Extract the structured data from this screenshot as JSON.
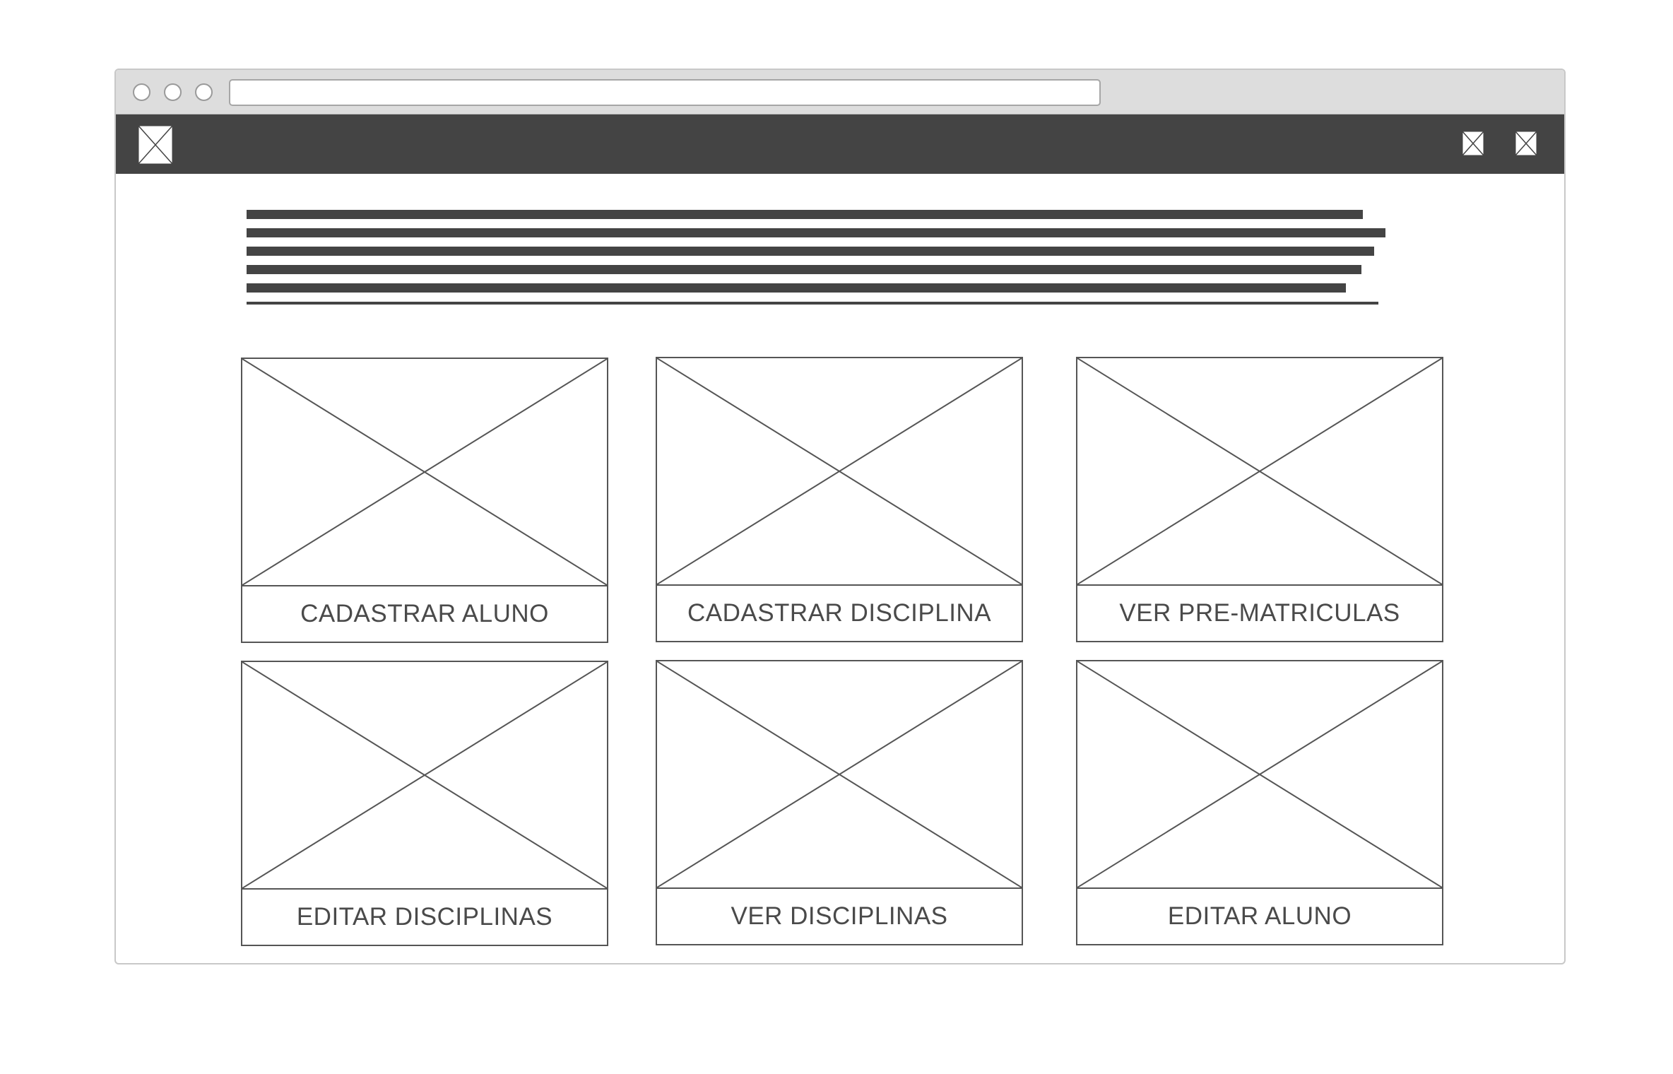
{
  "browser": {
    "window_controls": [
      "close",
      "minimize",
      "maximize"
    ],
    "address_bar": {
      "value": ""
    }
  },
  "navbar": {
    "logo_icon": "image-placeholder-icon",
    "right_icons": [
      "image-placeholder-icon",
      "image-placeholder-icon"
    ],
    "background": "#444444"
  },
  "intro_text": {
    "line_count": 6
  },
  "cards": [
    {
      "label": "CADASTRAR ALUNO",
      "icon": "image-placeholder-icon"
    },
    {
      "label": "CADASTRAR DISCIPLINA",
      "icon": "image-placeholder-icon"
    },
    {
      "label": "VER PRE-MATRICULAS",
      "icon": "image-placeholder-icon"
    },
    {
      "label": "EDITAR DISCIPLINAS",
      "icon": "image-placeholder-icon"
    },
    {
      "label": "VER DISCIPLINAS",
      "icon": "image-placeholder-icon"
    },
    {
      "label": "EDITAR ALUNO",
      "icon": "image-placeholder-icon"
    }
  ],
  "colors": {
    "chrome": "#dddddd",
    "navbar": "#444444",
    "wireframe_stroke": "#555555",
    "label_text": "#4a4a4a"
  }
}
